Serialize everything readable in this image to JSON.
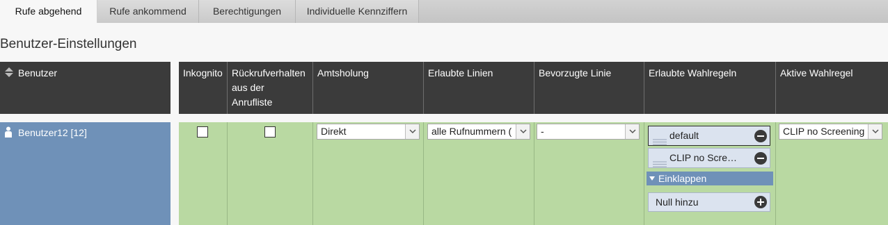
{
  "tabs": [
    {
      "label": "Rufe abgehend",
      "active": true
    },
    {
      "label": "Rufe ankommend",
      "active": false
    },
    {
      "label": "Berechtigungen",
      "active": false
    },
    {
      "label": "Individuelle Kennziffern",
      "active": false
    }
  ],
  "section_title": "Benutzer-Einstellungen",
  "columns": {
    "user": "Benutzer",
    "incognito": "Inkognito",
    "callback_line1": "Rückrufverhalten",
    "callback_line2": "aus der",
    "callback_line3": "Anrufliste",
    "trunk": "Amtsholung",
    "allowed_lines": "Erlaubte Linien",
    "preferred_line": "Bevorzugte Linie",
    "allowed_rules": "Erlaubte Wahlregeln",
    "active_rule": "Aktive Wahlregel"
  },
  "row": {
    "user": "Benutzer12 [12]",
    "trunk": "Direkt",
    "allowed_lines": "alle Rufnummern (",
    "preferred_line": "-",
    "rules": [
      "default",
      "CLIP no Scre…"
    ],
    "collapse_label": "Einklappen",
    "add_label": "Null hinzu",
    "active_rule": "CLIP no Screening"
  },
  "colors": {
    "header_bg": "#3b3b3b",
    "row_bg": "#b9d9a2",
    "user_bg": "#6f91b8",
    "rule_bg": "#dbe3ef"
  },
  "icons": [
    "sort-icon",
    "person-icon",
    "chevron-down-icon",
    "drag-handle-icon",
    "remove-icon",
    "add-icon",
    "triangle-down-icon"
  ]
}
